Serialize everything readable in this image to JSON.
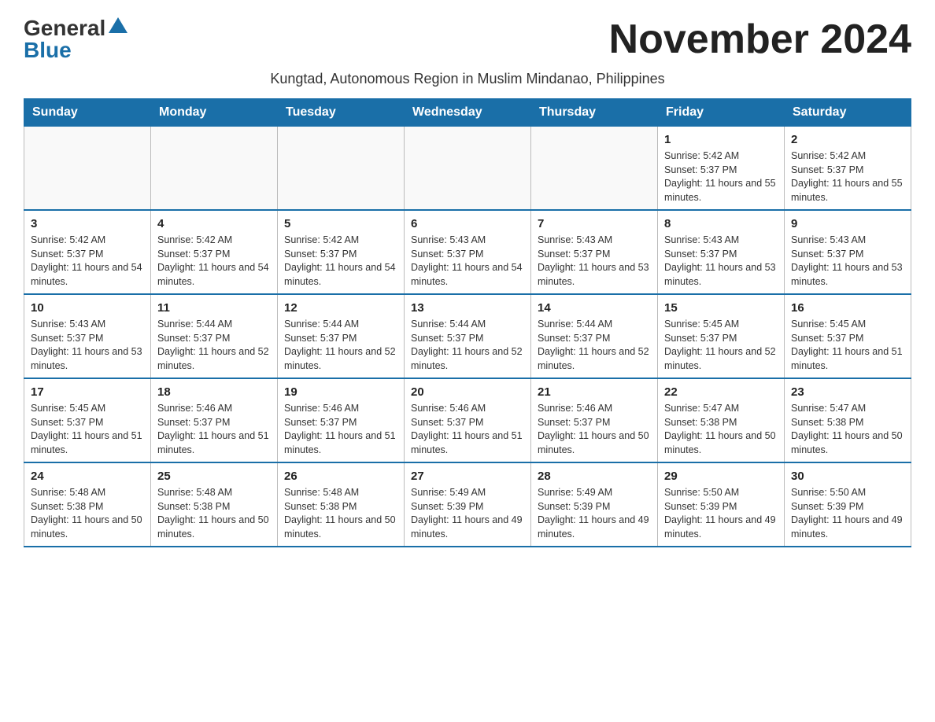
{
  "header": {
    "logo_general": "General",
    "logo_blue": "Blue",
    "title": "November 2024",
    "subtitle": "Kungtad, Autonomous Region in Muslim Mindanao, Philippines"
  },
  "days_of_week": [
    "Sunday",
    "Monday",
    "Tuesday",
    "Wednesday",
    "Thursday",
    "Friday",
    "Saturday"
  ],
  "weeks": [
    [
      {
        "day": "",
        "info": ""
      },
      {
        "day": "",
        "info": ""
      },
      {
        "day": "",
        "info": ""
      },
      {
        "day": "",
        "info": ""
      },
      {
        "day": "",
        "info": ""
      },
      {
        "day": "1",
        "info": "Sunrise: 5:42 AM\nSunset: 5:37 PM\nDaylight: 11 hours and 55 minutes."
      },
      {
        "day": "2",
        "info": "Sunrise: 5:42 AM\nSunset: 5:37 PM\nDaylight: 11 hours and 55 minutes."
      }
    ],
    [
      {
        "day": "3",
        "info": "Sunrise: 5:42 AM\nSunset: 5:37 PM\nDaylight: 11 hours and 54 minutes."
      },
      {
        "day": "4",
        "info": "Sunrise: 5:42 AM\nSunset: 5:37 PM\nDaylight: 11 hours and 54 minutes."
      },
      {
        "day": "5",
        "info": "Sunrise: 5:42 AM\nSunset: 5:37 PM\nDaylight: 11 hours and 54 minutes."
      },
      {
        "day": "6",
        "info": "Sunrise: 5:43 AM\nSunset: 5:37 PM\nDaylight: 11 hours and 54 minutes."
      },
      {
        "day": "7",
        "info": "Sunrise: 5:43 AM\nSunset: 5:37 PM\nDaylight: 11 hours and 53 minutes."
      },
      {
        "day": "8",
        "info": "Sunrise: 5:43 AM\nSunset: 5:37 PM\nDaylight: 11 hours and 53 minutes."
      },
      {
        "day": "9",
        "info": "Sunrise: 5:43 AM\nSunset: 5:37 PM\nDaylight: 11 hours and 53 minutes."
      }
    ],
    [
      {
        "day": "10",
        "info": "Sunrise: 5:43 AM\nSunset: 5:37 PM\nDaylight: 11 hours and 53 minutes."
      },
      {
        "day": "11",
        "info": "Sunrise: 5:44 AM\nSunset: 5:37 PM\nDaylight: 11 hours and 52 minutes."
      },
      {
        "day": "12",
        "info": "Sunrise: 5:44 AM\nSunset: 5:37 PM\nDaylight: 11 hours and 52 minutes."
      },
      {
        "day": "13",
        "info": "Sunrise: 5:44 AM\nSunset: 5:37 PM\nDaylight: 11 hours and 52 minutes."
      },
      {
        "day": "14",
        "info": "Sunrise: 5:44 AM\nSunset: 5:37 PM\nDaylight: 11 hours and 52 minutes."
      },
      {
        "day": "15",
        "info": "Sunrise: 5:45 AM\nSunset: 5:37 PM\nDaylight: 11 hours and 52 minutes."
      },
      {
        "day": "16",
        "info": "Sunrise: 5:45 AM\nSunset: 5:37 PM\nDaylight: 11 hours and 51 minutes."
      }
    ],
    [
      {
        "day": "17",
        "info": "Sunrise: 5:45 AM\nSunset: 5:37 PM\nDaylight: 11 hours and 51 minutes."
      },
      {
        "day": "18",
        "info": "Sunrise: 5:46 AM\nSunset: 5:37 PM\nDaylight: 11 hours and 51 minutes."
      },
      {
        "day": "19",
        "info": "Sunrise: 5:46 AM\nSunset: 5:37 PM\nDaylight: 11 hours and 51 minutes."
      },
      {
        "day": "20",
        "info": "Sunrise: 5:46 AM\nSunset: 5:37 PM\nDaylight: 11 hours and 51 minutes."
      },
      {
        "day": "21",
        "info": "Sunrise: 5:46 AM\nSunset: 5:37 PM\nDaylight: 11 hours and 50 minutes."
      },
      {
        "day": "22",
        "info": "Sunrise: 5:47 AM\nSunset: 5:38 PM\nDaylight: 11 hours and 50 minutes."
      },
      {
        "day": "23",
        "info": "Sunrise: 5:47 AM\nSunset: 5:38 PM\nDaylight: 11 hours and 50 minutes."
      }
    ],
    [
      {
        "day": "24",
        "info": "Sunrise: 5:48 AM\nSunset: 5:38 PM\nDaylight: 11 hours and 50 minutes."
      },
      {
        "day": "25",
        "info": "Sunrise: 5:48 AM\nSunset: 5:38 PM\nDaylight: 11 hours and 50 minutes."
      },
      {
        "day": "26",
        "info": "Sunrise: 5:48 AM\nSunset: 5:38 PM\nDaylight: 11 hours and 50 minutes."
      },
      {
        "day": "27",
        "info": "Sunrise: 5:49 AM\nSunset: 5:39 PM\nDaylight: 11 hours and 49 minutes."
      },
      {
        "day": "28",
        "info": "Sunrise: 5:49 AM\nSunset: 5:39 PM\nDaylight: 11 hours and 49 minutes."
      },
      {
        "day": "29",
        "info": "Sunrise: 5:50 AM\nSunset: 5:39 PM\nDaylight: 11 hours and 49 minutes."
      },
      {
        "day": "30",
        "info": "Sunrise: 5:50 AM\nSunset: 5:39 PM\nDaylight: 11 hours and 49 minutes."
      }
    ]
  ]
}
